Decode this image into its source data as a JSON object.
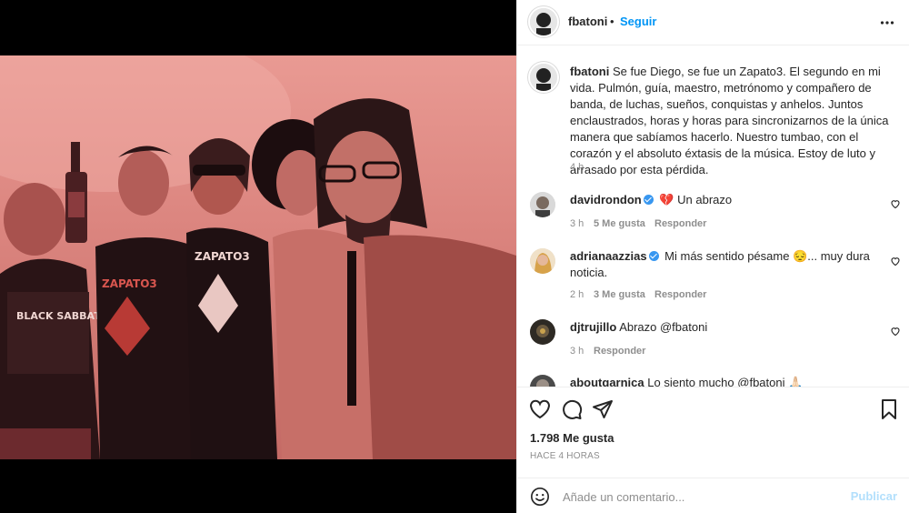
{
  "post": {
    "username": "fbatoni",
    "separator": "•",
    "follow_label": "Seguir",
    "caption_user": "fbatoni",
    "caption": "Se fue Diego, se fue un Zapato3. El segundo en mi vida. Pulmón, guía, maestro, metrónomo y compañero de banda, de luchas, sueños, conquistas y anhelos. Juntos enclaustrados, horas y horas para sincronizarnos de la única manera que sabíamos hacerlo. Nuestro tumbao, con el corazón y el absoluto éxtasis de la música. Estoy de luto y arrasado por esta pérdida.",
    "caption_time": "4 h",
    "likes": "1.798 Me gusta",
    "posted": "HACE 4 HORAS"
  },
  "photo": {
    "shirt_left_text": "BLACK SABBATH",
    "shirt_mid_text": "ZAPATO3",
    "shirt_right_text": "ZAPATO3"
  },
  "comments": [
    {
      "user": "davidrondon",
      "verified": true,
      "text": "💔 Un abrazo",
      "time": "3 h",
      "likes": "5 Me gusta",
      "reply": "Responder"
    },
    {
      "user": "adrianaazzias",
      "verified": true,
      "text": "Mi más sentido pésame 😔... muy dura noticia.",
      "time": "2 h",
      "likes": "3 Me gusta",
      "reply": "Responder"
    },
    {
      "user": "djtrujillo",
      "verified": false,
      "text": "Abrazo @fbatoni",
      "time": "3 h",
      "likes": "",
      "reply": "Responder"
    },
    {
      "user": "aboutgarnica",
      "verified": false,
      "text": "Lo siento mucho @fbatoni 🙏🏻"
    }
  ],
  "add_comment": {
    "placeholder": "Añade un comentario...",
    "post_label": "Publicar"
  },
  "colors": {
    "link": "#0095f6",
    "muted": "#8e8e8e",
    "photo_tint": "#dc8680"
  },
  "icons": [
    "more-icon",
    "heart-icon",
    "comment-icon",
    "share-icon",
    "bookmark-icon",
    "emoji-icon",
    "verified-icon"
  ]
}
